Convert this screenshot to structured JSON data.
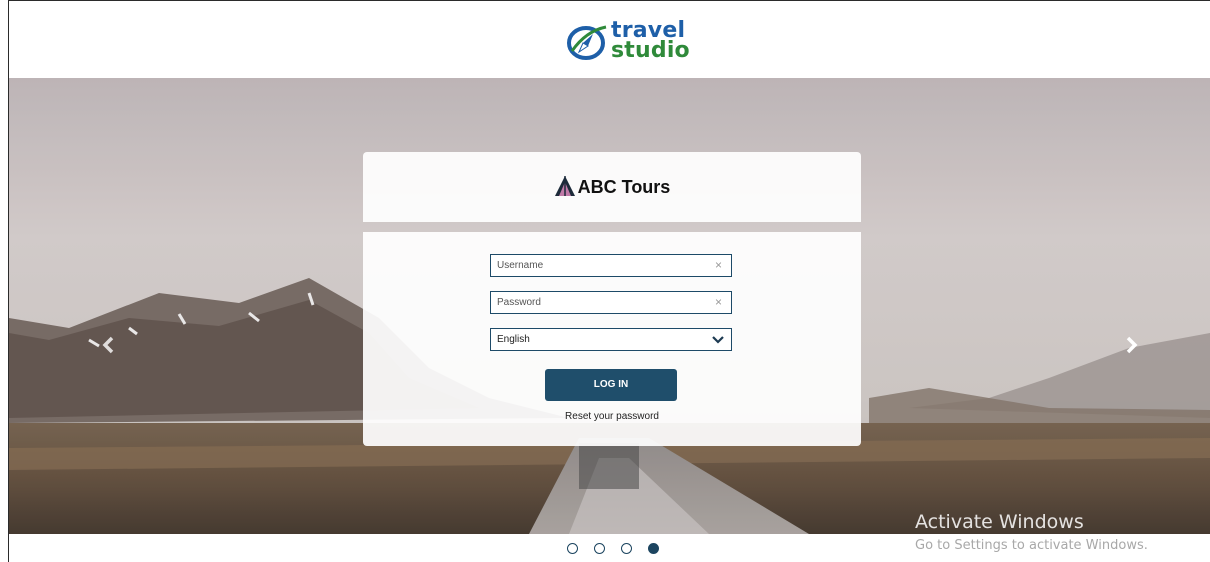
{
  "header": {
    "logo": {
      "word1": "travel",
      "word2": "studio",
      "colors": {
        "blue": "#1e5fa8",
        "green": "#2f8a3a"
      }
    }
  },
  "carousel": {
    "prev_icon": "chevron-left-icon",
    "next_icon": "chevron-right-icon",
    "slide_count": 4,
    "active_index": 3
  },
  "login": {
    "brand_name": "ABC Tours",
    "brand_icon": "tent-icon",
    "username": {
      "placeholder": "Username",
      "value": ""
    },
    "password": {
      "placeholder": "Password",
      "value": ""
    },
    "language": {
      "selected": "English"
    },
    "login_button": "LOG IN",
    "reset_link": "Reset your password"
  },
  "watermark": {
    "title": "Activate Windows",
    "subtitle": "Go to Settings to activate Windows."
  },
  "colors": {
    "accent": "#1f4e6b",
    "dot": "#1c4560"
  }
}
